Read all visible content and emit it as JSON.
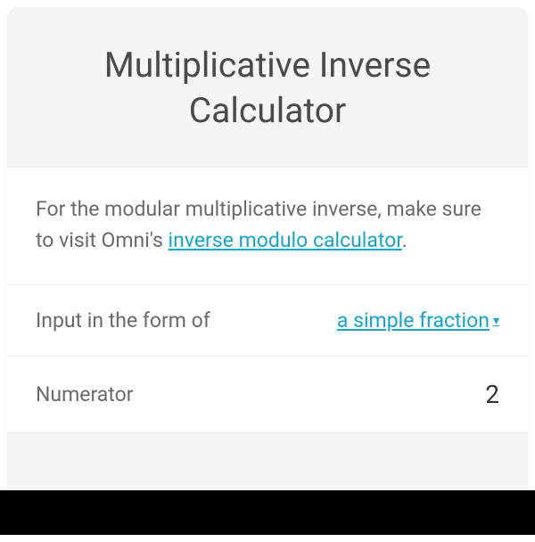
{
  "title": "Multiplicative Inverse Calculator",
  "info": {
    "prefix": "For the modular multiplicative inverse, make sure to visit Omni's ",
    "linkText": "inverse modulo calculator",
    "suffix": "."
  },
  "inputRow": {
    "label": "Input in the form of",
    "dropdownValue": "a simple fraction"
  },
  "numeratorRow": {
    "label": "Numerator",
    "value": "2"
  }
}
